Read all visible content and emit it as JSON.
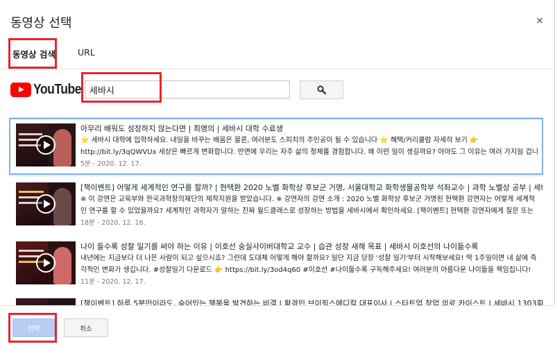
{
  "dialog": {
    "title": "동영상 선택",
    "close_icon": "×"
  },
  "tabs": [
    {
      "label": "동영상 검색",
      "active": true
    },
    {
      "label": "URL",
      "active": false
    }
  ],
  "search": {
    "logo_text": "YouTube",
    "query": "세바시",
    "button_icon": "search-icon"
  },
  "results": [
    {
      "title": "아무리 배워도 성장하지 않는다면 | 최명의 | 세바시 대학 수료생",
      "desc": "⭐ 세바시 대학에 입학하세요. 내일을 바꾸는 배움은 물론, 여러분도 스피치의 주인공이 될 수 있습니다 ⭐ 혜택/커리큘럼 자세히 보기 👉 http://bit.ly/3qQWVUx 세상은 빠르게 변화합니다. 반면에 우리는 자주 삶의 정체를 경험합니다. 왜 이런 일이 생길까요? 아마도 그 이유는 여러 가지일 겁니다. 세",
      "meta": "5분 - 2020. 12. 17.",
      "selected": true
    },
    {
      "title": "[책이벤트] 어떻게 세계적인 연구를 할까? | 현택환 2020 노벨 화학상 후보군 거명, 서울대학교 화학생물공학부 석좌교수 | 과학 노벨상 공부 | 세바시 1303회",
      "desc": "※ 이 강연은 교육부와 한국과학창의재단의 제작지원을 받았습니다. ※ 강연자의 강연 소개 : 2020 노벨 화학상 후보군 거명된 현택환 강연자는 어떻게 세계적인 연구를 할 수 있었을까요? 세계적인 과학자가 말하는 진짜 월드클래스로 성장하는 방법을 세바시에서 확인하세요. [책이벤트] 현택환 강연자에게 질문 또는 시청소감을 댓글로 남겨",
      "meta": "18분 - 2020. 12. 16.",
      "selected": false
    },
    {
      "title": "나이 들수록 성찰 일기를 써야 하는 이유 | 이호선 숭실사이버대학교 교수 | 습관 성장 새해 목표 | 세바시 이호선의 나이듦수록",
      "desc": "내년에는 지금보다 더 나은 사람이 되고 싶으시죠? 그런데 도대체 어떻게 해야 할까요? 일단 지금 당장 '성찰 일기'부터 시작해보세요! 딱 1주일이면 내 삶에 즉각적인 변화가 생깁니다. #성찰일기 다운로드 👉 https://bit.ly/3od4q60 #이호선 #나이듦수록 구독해주세요! 여러분의 아름다운 나이듦을 책임집니다! 구독해도 나이 안",
      "meta": "11분 - 2020. 12. 17.",
      "selected": false
    },
    {
      "title": "[책이벤트] 하루 5분만이라도, 숨어있는 행복을 발견하는 비결 | 황경민 브이픽스메디칼 대표이사 | 스타트업 창업 의료 카이스트 | 세바시 1303회",
      "desc": "",
      "meta": "",
      "selected": false
    }
  ],
  "footer": {
    "select_label": "선택",
    "cancel_label": "취소"
  },
  "colors": {
    "highlight_box": "#e8242c",
    "selected_border": "#7fb1e6",
    "tab_accent": "#dd4b39"
  }
}
